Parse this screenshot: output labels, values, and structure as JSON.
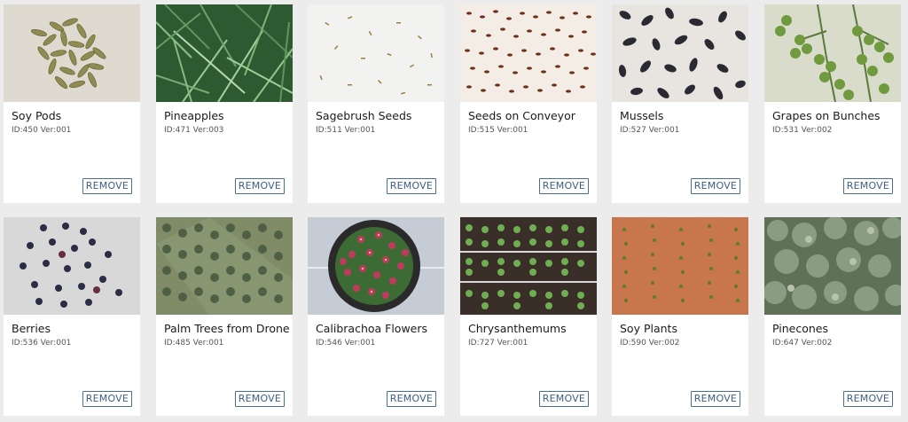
{
  "remove_label": "REMOVE",
  "cards": [
    {
      "title": "Soy Pods",
      "meta": "ID:450 Ver:001",
      "icon": "soy-pods-thumbnail"
    },
    {
      "title": "Pineapples",
      "meta": "ID:471 Ver:003",
      "icon": "pineapples-thumbnail"
    },
    {
      "title": "Sagebrush Seeds",
      "meta": "ID:511 Ver:001",
      "icon": "sagebrush-seeds-thumbnail"
    },
    {
      "title": "Seeds on Conveyor",
      "meta": "ID:515 Ver:001",
      "icon": "seeds-conveyor-thumbnail"
    },
    {
      "title": "Mussels",
      "meta": "ID:527 Ver:001",
      "icon": "mussels-thumbnail"
    },
    {
      "title": "Grapes on Bunches",
      "meta": "ID:531 Ver:002",
      "icon": "grapes-thumbnail"
    },
    {
      "title": "Berries",
      "meta": "ID:536 Ver:001",
      "icon": "berries-thumbnail"
    },
    {
      "title": "Palm Trees from Drone",
      "meta": "ID:485 Ver:001",
      "icon": "palm-trees-thumbnail"
    },
    {
      "title": "Calibrachoa Flowers",
      "meta": "ID:546 Ver:001",
      "icon": "calibrachoa-thumbnail"
    },
    {
      "title": "Chrysanthemums",
      "meta": "ID:727 Ver:001",
      "icon": "chrysanthemums-thumbnail"
    },
    {
      "title": "Soy Plants",
      "meta": "ID:590 Ver:002",
      "icon": "soy-plants-thumbnail"
    },
    {
      "title": "Pinecones",
      "meta": "ID:647 Ver:002",
      "icon": "pinecones-thumbnail"
    }
  ]
}
